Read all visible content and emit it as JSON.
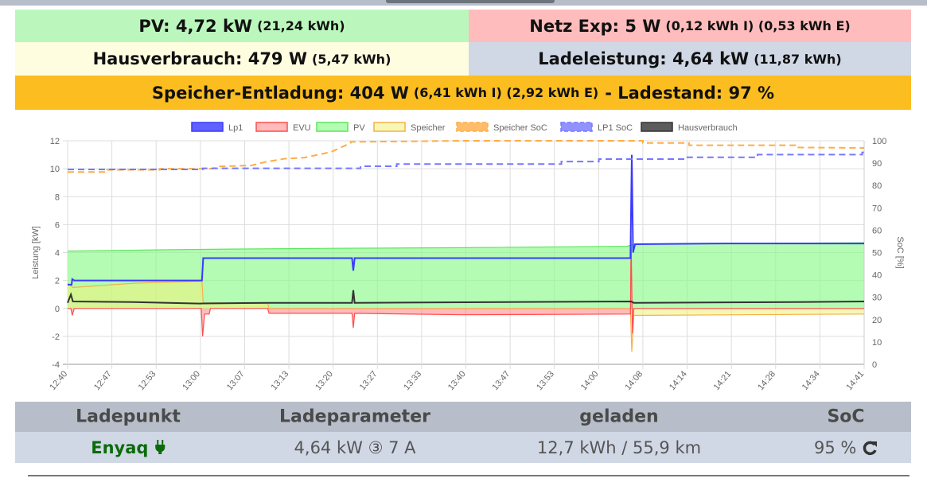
{
  "summary": {
    "pv": {
      "label": "PV: 4,72 kW",
      "detail": "(21,24 kWh)",
      "color": "#bbf7bc"
    },
    "netz": {
      "label": "Netz Exp: 5 W",
      "detail": "(0,12 kWh I) (0,53 kWh E)",
      "color": "#ffbcbc"
    },
    "haus": {
      "label": "Hausverbrauch: 479 W",
      "detail": "(5,47 kWh)",
      "color": "#fefde0"
    },
    "lade": {
      "label": "Ladeleistung: 4,64 kW",
      "detail": "(11,87 kWh)",
      "color": "#d0d8e6"
    },
    "speicher": {
      "label": "Speicher-Entladung: 404 W",
      "detail": "(6,41 kWh I) (2,92 kWh E)",
      "suffix": "- Ladestand: 97 %",
      "color": "#fbbd1f"
    }
  },
  "chart_data": {
    "type": "line",
    "ylabel": "Leistung [kW]",
    "y2label": "SoC [%]",
    "ylim": [
      -4,
      12
    ],
    "yticks": [
      -4,
      -2,
      0,
      2,
      4,
      6,
      8,
      10,
      12
    ],
    "y2lim": [
      0,
      100
    ],
    "y2ticks": [
      0,
      10,
      20,
      30,
      40,
      50,
      60,
      70,
      80,
      90,
      100
    ],
    "xlim": [
      0,
      121
    ],
    "xticks": [
      "12:40",
      "12:47",
      "12:53",
      "13:00",
      "13:07",
      "13:13",
      "13:20",
      "13:27",
      "13:33",
      "13:40",
      "13:47",
      "13:53",
      "14:00",
      "14:08",
      "14:14",
      "14:21",
      "14:28",
      "14:34",
      "14:41"
    ],
    "legend_position": "top",
    "series": [
      {
        "name": "Lp1",
        "color": "#3a3aff",
        "fill": null,
        "axis": "left",
        "dash": false,
        "points": [
          [
            0,
            1.7
          ],
          [
            0.6,
            1.7
          ],
          [
            0.7,
            2.1
          ],
          [
            1,
            2.0
          ],
          [
            20.4,
            2.0
          ],
          [
            20.6,
            3.6
          ],
          [
            43.2,
            3.6
          ],
          [
            43.4,
            2.7
          ],
          [
            43.6,
            3.6
          ],
          [
            85.5,
            3.6
          ],
          [
            85.7,
            11
          ],
          [
            85.9,
            4.0
          ],
          [
            86.2,
            4.6
          ],
          [
            100,
            4.65
          ],
          [
            121,
            4.65
          ]
        ]
      },
      {
        "name": "EVU",
        "color": "#ff4d4d",
        "fill": "rgba(255,120,120,0.5)",
        "axis": "left",
        "dash": false,
        "points": [
          [
            0,
            0
          ],
          [
            0.5,
            0
          ],
          [
            0.7,
            -0.5
          ],
          [
            1,
            0
          ],
          [
            20.3,
            0
          ],
          [
            20.5,
            -2.0
          ],
          [
            20.8,
            -0.4
          ],
          [
            21.5,
            -0.4
          ],
          [
            21.7,
            0
          ],
          [
            30.4,
            0
          ],
          [
            30.6,
            -0.35
          ],
          [
            43.2,
            -0.35
          ],
          [
            43.4,
            -1.4
          ],
          [
            43.6,
            -0.35
          ],
          [
            60,
            -0.45
          ],
          [
            85.5,
            -0.4
          ],
          [
            85.6,
            5.2
          ],
          [
            85.8,
            -1.8
          ],
          [
            86,
            0
          ],
          [
            121,
            0
          ]
        ]
      },
      {
        "name": "PV",
        "color": "#5ce65c",
        "fill": "rgba(140,250,140,0.65)",
        "axis": "left",
        "dash": false,
        "points": [
          [
            0,
            4.1
          ],
          [
            15,
            4.2
          ],
          [
            25,
            4.25
          ],
          [
            40,
            4.3
          ],
          [
            60,
            4.35
          ],
          [
            85,
            4.45
          ],
          [
            86,
            4.6
          ],
          [
            121,
            4.7
          ]
        ]
      },
      {
        "name": "Speicher",
        "color": "#f5b04a",
        "fill": "rgba(240,240,120,0.55)",
        "axis": "left",
        "dash": false,
        "points": [
          [
            0,
            1.8
          ],
          [
            0.8,
            1.5
          ],
          [
            10,
            1.8
          ],
          [
            20.4,
            1.95
          ],
          [
            20.6,
            0.4
          ],
          [
            30.4,
            0.35
          ],
          [
            30.6,
            0
          ],
          [
            85.5,
            0
          ],
          [
            85.7,
            -3.1
          ],
          [
            86,
            -0.5
          ],
          [
            121,
            -0.4
          ]
        ]
      },
      {
        "name": "Speicher SoC",
        "color": "#ffad46",
        "fill": null,
        "axis": "right",
        "dash": true,
        "points": [
          [
            0,
            86
          ],
          [
            6,
            86
          ],
          [
            6,
            87
          ],
          [
            14,
            87
          ],
          [
            14,
            87.5
          ],
          [
            22,
            87.5
          ],
          [
            23,
            88.5
          ],
          [
            28,
            89
          ],
          [
            30,
            90.5
          ],
          [
            33,
            92
          ],
          [
            36,
            92.5
          ],
          [
            40,
            95
          ],
          [
            43,
            99
          ],
          [
            43,
            99.5
          ],
          [
            60,
            100
          ],
          [
            87.4,
            100
          ],
          [
            87.4,
            99
          ],
          [
            94.4,
            99
          ],
          [
            94.4,
            98
          ],
          [
            110.9,
            98
          ],
          [
            110.9,
            97
          ],
          [
            121,
            96.8
          ]
        ]
      },
      {
        "name": "LP1 SoC",
        "color": "#7777ff",
        "fill": null,
        "axis": "right",
        "dash": true,
        "points": [
          [
            0,
            87.2
          ],
          [
            20.5,
            87.2
          ],
          [
            20.5,
            87.7
          ],
          [
            44.5,
            87.7
          ],
          [
            44.5,
            88.6
          ],
          [
            50,
            88.6
          ],
          [
            50,
            89.6
          ],
          [
            75,
            89.6
          ],
          [
            75,
            90.7
          ],
          [
            80.7,
            90.7
          ],
          [
            80.7,
            91.8
          ],
          [
            94,
            91.8
          ],
          [
            94,
            92.6
          ],
          [
            104.8,
            92.6
          ],
          [
            104.8,
            93.8
          ],
          [
            120.7,
            93.8
          ],
          [
            120.7,
            94.8
          ],
          [
            121,
            94.8
          ]
        ]
      },
      {
        "name": "Hausverbrauch",
        "color": "#333333",
        "fill": null,
        "axis": "left",
        "dash": false,
        "points": [
          [
            0,
            0.4
          ],
          [
            0.5,
            1.0
          ],
          [
            0.8,
            0.5
          ],
          [
            10,
            0.45
          ],
          [
            20,
            0.35
          ],
          [
            30,
            0.4
          ],
          [
            43.2,
            0.4
          ],
          [
            43.4,
            1.3
          ],
          [
            43.6,
            0.4
          ],
          [
            85.6,
            0.5
          ],
          [
            86,
            0.4
          ],
          [
            110,
            0.45
          ],
          [
            121,
            0.5
          ]
        ]
      }
    ]
  },
  "table": {
    "headers": [
      "Ladepunkt",
      "Ladeparameter",
      "geladen",
      "SoC"
    ],
    "row": {
      "name": "Enyaq",
      "plug_icon": "plug-icon",
      "params": "4,64 kW ③ 7 A",
      "charged": "12,7 kWh / 55,9 km",
      "soc": "95 %",
      "refresh_icon": "refresh-icon"
    }
  }
}
